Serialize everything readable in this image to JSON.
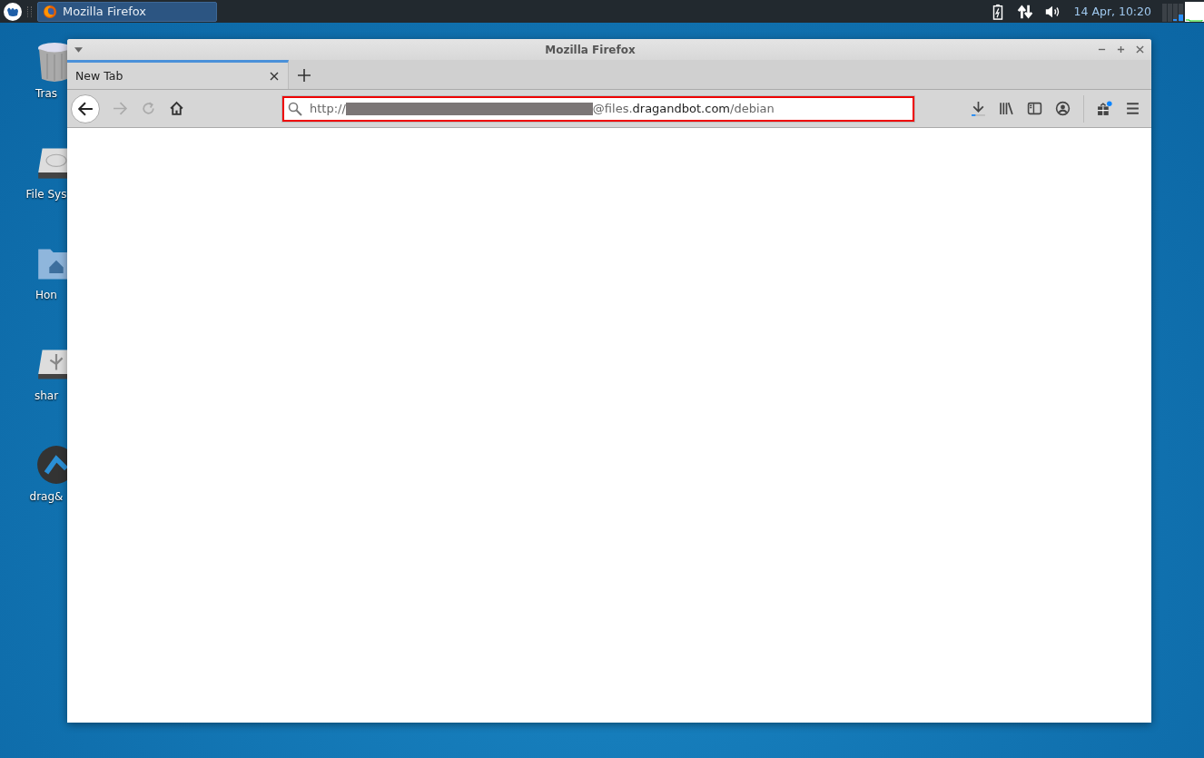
{
  "taskbar": {
    "tasks": [
      {
        "title": "Mozilla Firefox",
        "selected": true
      }
    ],
    "clock": "14 Apr, 10:20"
  },
  "desktop_icons": [
    {
      "kind": "trash",
      "label": "Tras"
    },
    {
      "kind": "drive",
      "label": "File Sys"
    },
    {
      "kind": "folder",
      "label": "Hon"
    },
    {
      "kind": "usb",
      "label": "shar"
    },
    {
      "kind": "app",
      "label": "drag&"
    }
  ],
  "window": {
    "title": "Mozilla Firefox",
    "tabs": [
      {
        "label": "New Tab",
        "selected": true
      }
    ],
    "toolbar": {
      "back_disabled": false,
      "forward_disabled": true
    },
    "address_bar": {
      "scheme": "http://",
      "redacted": true,
      "host_prefix": "@files.",
      "domain": "dragandbot.com",
      "path": "/debian"
    },
    "whats_new_badge": true
  }
}
